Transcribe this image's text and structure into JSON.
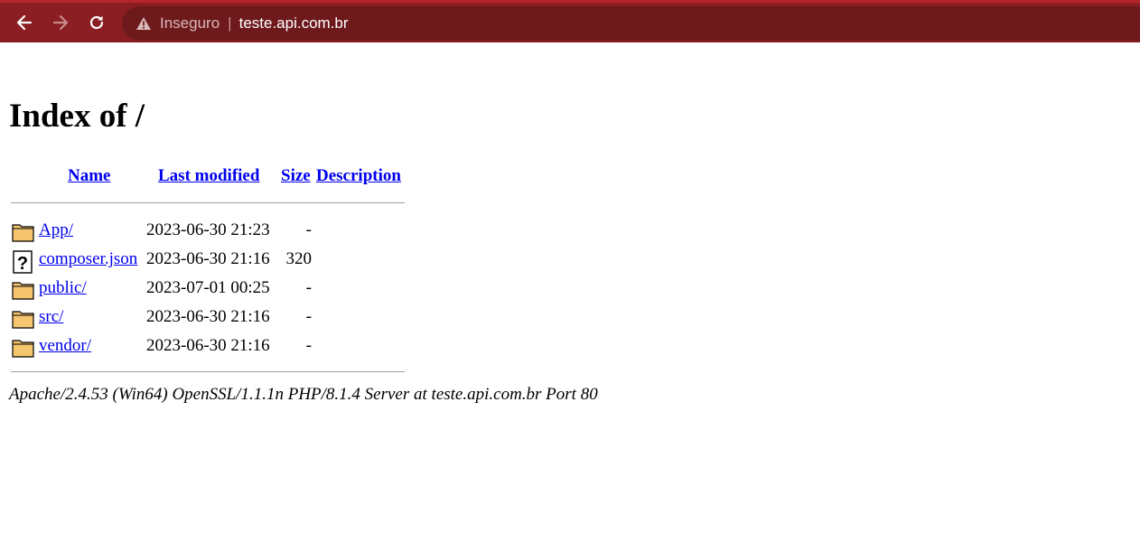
{
  "browser": {
    "back_icon": "arrow-left-icon",
    "forward_icon": "arrow-right-icon",
    "reload_icon": "reload-icon",
    "security_icon": "warning-triangle-icon",
    "security_label": "Inseguro",
    "separator": "|",
    "url": "teste.api.com.br",
    "toolbar_color": "#8b1e22"
  },
  "page": {
    "title": "Index of /",
    "columns": {
      "name": "Name",
      "last_modified": "Last modified",
      "size": "Size",
      "description": "Description"
    },
    "entries": [
      {
        "icon": "folder-icon",
        "name": "App/",
        "modified": "2023-06-30 21:23",
        "size": "-",
        "description": ""
      },
      {
        "icon": "unknown-file-icon",
        "name": "composer.json",
        "modified": "2023-06-30 21:16",
        "size": "320",
        "description": ""
      },
      {
        "icon": "folder-icon",
        "name": "public/",
        "modified": "2023-07-01 00:25",
        "size": "-",
        "description": ""
      },
      {
        "icon": "folder-icon",
        "name": "src/",
        "modified": "2023-06-30 21:16",
        "size": "-",
        "description": ""
      },
      {
        "icon": "folder-icon",
        "name": "vendor/",
        "modified": "2023-06-30 21:16",
        "size": "-",
        "description": ""
      }
    ],
    "footer": "Apache/2.4.53 (Win64) OpenSSL/1.1.1n PHP/8.1.4 Server at teste.api.com.br Port 80",
    "link_color": "#0000ee"
  }
}
